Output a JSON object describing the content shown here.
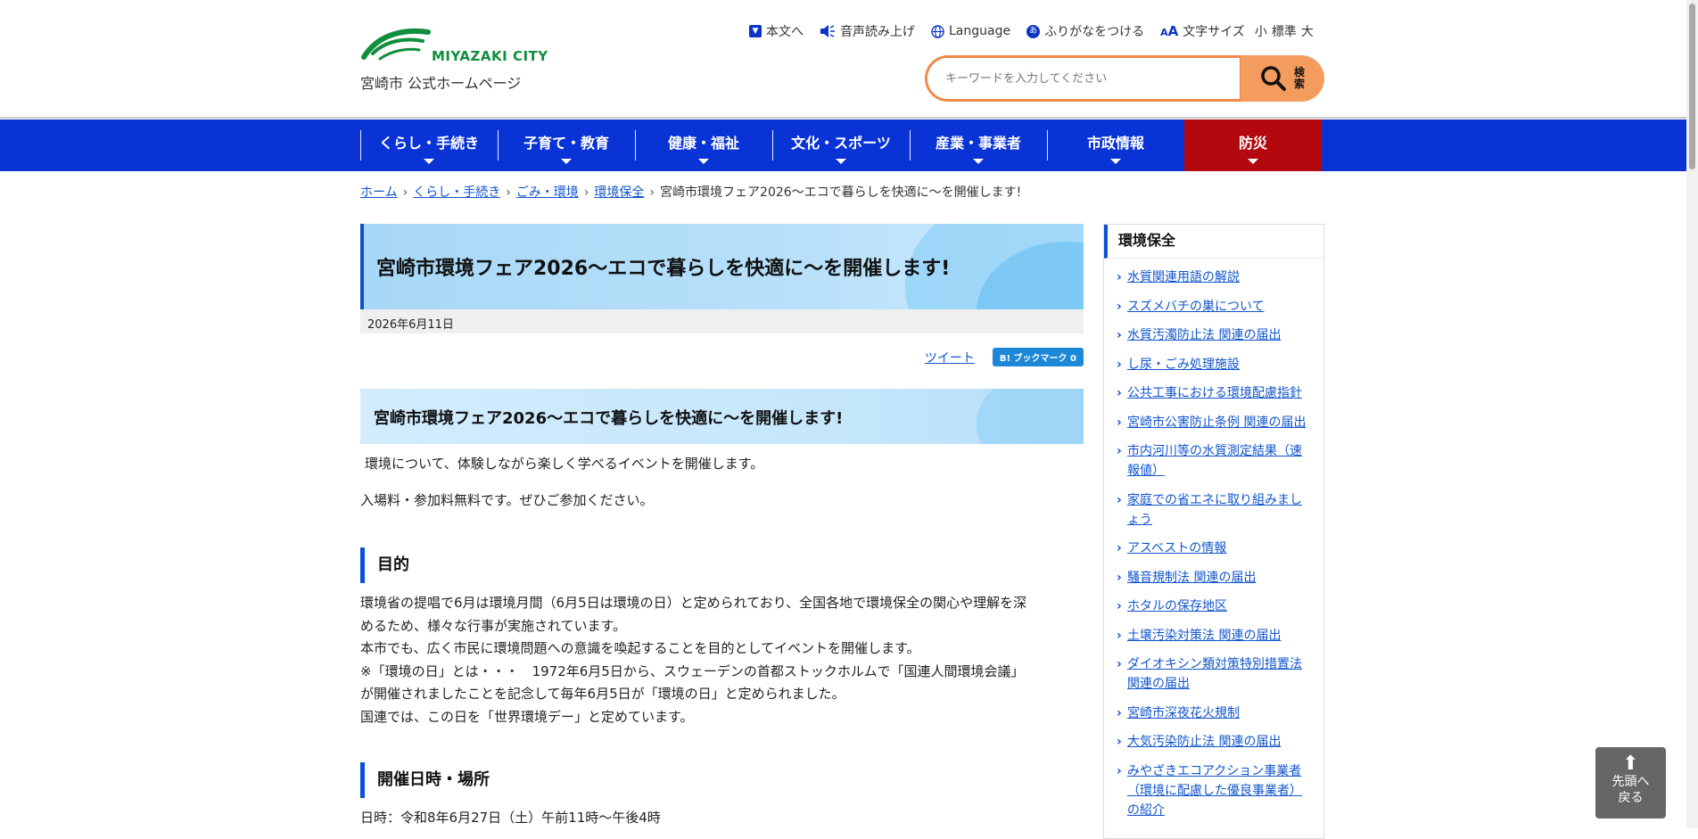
{
  "header": {
    "logo_text": "MIYAZAKI CITY",
    "logo_sub": "宮崎市 公式ホームページ",
    "utility": {
      "skip": "本文へ",
      "read_aloud": "音声読み上げ",
      "language": "Language",
      "furigana": "ふりがなをつける",
      "text_size": "文字サイズ",
      "size_small": "小",
      "size_normal": "標準",
      "size_large": "大"
    },
    "search": {
      "placeholder": "キーワードを入力してください",
      "button_label": "検索"
    }
  },
  "nav": {
    "items": [
      "くらし・手続き",
      "子育て・教育",
      "健康・福祉",
      "文化・スポーツ",
      "産業・事業者",
      "市政情報",
      "防災"
    ]
  },
  "breadcrumb": [
    "ホーム",
    "くらし・手続き",
    "ごみ・環境",
    "環境保全",
    "宮崎市環境フェア2026～エコで暮らしを快適に～を開催します!"
  ],
  "main": {
    "title": "宮崎市環境フェア2026～エコで暮らしを快適に～を開催します!",
    "date": "2026年6月11日",
    "share_tweet": "ツイート",
    "share_hatena": "B! ブックマーク  0",
    "subtitle": "宮崎市環境フェア2026～エコで暮らしを快適に～を開催します!",
    "intro1": "環境について、体験しながら楽しく学べるイベントを開催します。",
    "intro2": "入場料・参加料無料です。ぜひご参加ください。",
    "section_purpose_heading": "目的",
    "purpose_lines": [
      "環境省の提唱で6月は環境月間（6月5日は環境の日）と定められており、全国各地で環境保全の関心や理解を深",
      "めるため、様々な行事が実施されています。",
      "本市でも、広く市民に環境問題への意識を喚起することを目的としてイベントを開催します。",
      "※「環境の日」とは・・・　1972年6月5日から、スウェーデンの首都ストックホルムで「国連人間環境会議」",
      "が開催されましたことを記念して毎年6月5日が「環境の日」と定められました。",
      "国連では、この日を「世界環境デー」と定めています。"
    ],
    "section_date_heading": "開催日時・場所",
    "date_line": "日時：令和8年6月27日（土）午前11時～午後4時"
  },
  "sidebar": {
    "title": "環境保全",
    "links": [
      "水質関連用語の解説",
      "スズメバチの巣について",
      "水質汚濁防止法 関連の届出",
      "し尿・ごみ処理施設",
      "公共工事における環境配慮指針",
      "宮崎市公害防止条例 関連の届出",
      "市内河川等の水質測定結果（速報値）",
      "家庭での省エネに取り組みましょう",
      "アスベストの情報",
      "騒音規制法 関連の届出",
      "ホタルの保存地区",
      "土壌汚染対策法 関連の届出",
      "ダイオキシン類対策特別措置法 関連の届出",
      "宮崎市深夜花火規制",
      "大気汚染防止法 関連の届出",
      "みやざきエコアクション事業者（環境に配慮した優良事業者）の紹介"
    ]
  },
  "to_top": {
    "line1": "先頭へ",
    "line2": "戻る"
  },
  "colors": {
    "nav_blue": "#0a33d6",
    "bousai_red": "#b3080d",
    "search_orange": "#f39c5e",
    "logo_green": "#0f8f3e"
  }
}
